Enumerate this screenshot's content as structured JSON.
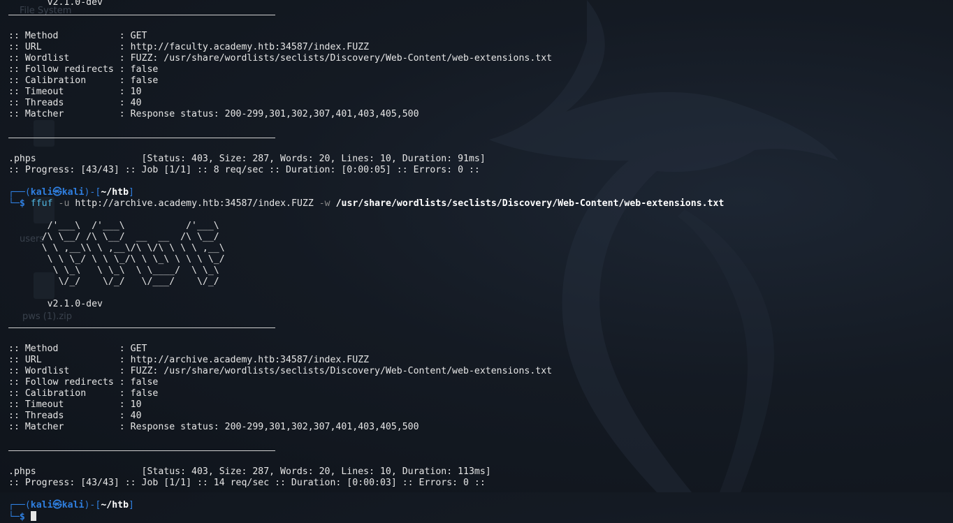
{
  "desktop": {
    "icons": [
      "File System",
      "users",
      "pws (1).zip"
    ]
  },
  "run1": {
    "version": "v2.1.0-dev",
    "config": [
      ":: Method           : GET",
      ":: URL              : http://faculty.academy.htb:34587/index.FUZZ",
      ":: Wordlist         : FUZZ: /usr/share/wordlists/seclists/Discovery/Web-Content/web-extensions.txt",
      ":: Follow redirects : false",
      ":: Calibration      : false",
      ":: Timeout          : 10",
      ":: Threads          : 40",
      ":: Matcher          : Response status: 200-299,301,302,307,401,403,405,500"
    ],
    "result": ".phps                   [Status: 403, Size: 287, Words: 20, Lines: 10, Duration: 91ms]",
    "progress": ":: Progress: [43/43] :: Job [1/1] :: 8 req/sec :: Duration: [0:00:05] :: Errors: 0 ::"
  },
  "prompt1": {
    "user": "kali",
    "host": "kali",
    "dir": "~/htb",
    "cmd": "ffuf",
    "flag_u": "-u",
    "url": "http://archive.academy.htb:34587/index.FUZZ",
    "flag_w": "-w",
    "path": "/usr/share/wordlists/seclists/Discovery/Web-Content/web-extensions.txt"
  },
  "banner": [
    "       /'___\\  /'___\\           /'___\\",
    "      /\\ \\__/ /\\ \\__/  __  __  /\\ \\__/",
    "      \\ \\ ,__\\\\ \\ ,__\\/\\ \\/\\ \\ \\ \\ ,__\\",
    "       \\ \\ \\_/ \\ \\ \\_/\\ \\ \\_\\ \\ \\ \\ \\_/",
    "        \\ \\_\\   \\ \\_\\  \\ \\____/  \\ \\_\\",
    "         \\/_/    \\/_/   \\/___/    \\/_/"
  ],
  "run2": {
    "version": "v2.1.0-dev",
    "config": [
      ":: Method           : GET",
      ":: URL              : http://archive.academy.htb:34587/index.FUZZ",
      ":: Wordlist         : FUZZ: /usr/share/wordlists/seclists/Discovery/Web-Content/web-extensions.txt",
      ":: Follow redirects : false",
      ":: Calibration      : false",
      ":: Timeout          : 10",
      ":: Threads          : 40",
      ":: Matcher          : Response status: 200-299,301,302,307,401,403,405,500"
    ],
    "result": ".phps                   [Status: 403, Size: 287, Words: 20, Lines: 10, Duration: 113ms]",
    "progress": ":: Progress: [43/43] :: Job [1/1] :: 14 req/sec :: Duration: [0:00:03] :: Errors: 0 ::"
  },
  "prompt2": {
    "user": "kali",
    "host": "kali",
    "dir": "~/htb"
  },
  "colors": {
    "prompt_blue": "#2f7fe0",
    "background": "#141a23"
  }
}
